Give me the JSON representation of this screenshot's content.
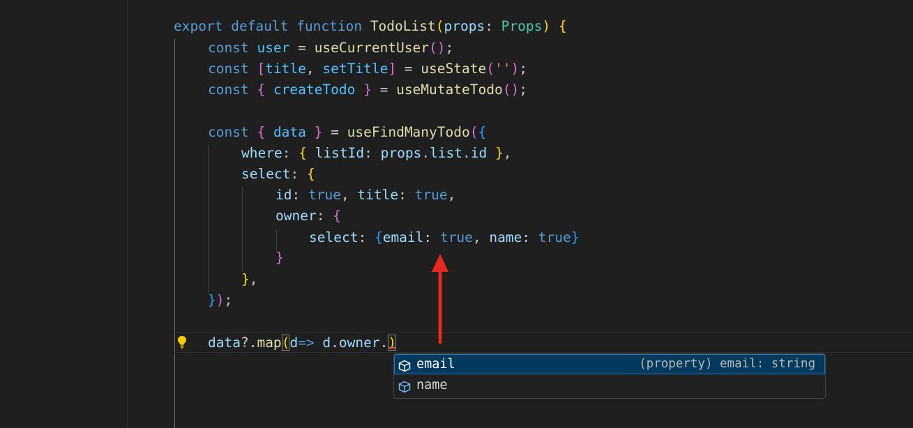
{
  "editor": {
    "language": "typescript",
    "lines": {
      "l1": [
        "export",
        "default",
        "function",
        "TodoList",
        "(",
        "props",
        ": ",
        "Props",
        ")",
        " {"
      ],
      "l2": [
        "const",
        "user",
        " = ",
        "useCurrentUser",
        "()",
        ";"
      ],
      "l3": [
        "const",
        "[",
        "title",
        ", ",
        "setTitle",
        "]",
        " = ",
        "useState",
        "(",
        "''",
        ")",
        ";"
      ],
      "l4": [
        "const",
        "{",
        " createTodo ",
        "}",
        " = ",
        "useMutateTodo",
        "()",
        ";"
      ],
      "l5": [
        "const",
        "{",
        " data ",
        "}",
        " = ",
        "useFindManyTodo",
        "(",
        "{"
      ],
      "l6": [
        "where",
        ": ",
        "{",
        " listId",
        ": ",
        "props",
        ".",
        "list",
        ".",
        "id",
        " }",
        ","
      ],
      "l7": [
        "select",
        ": ",
        "{"
      ],
      "l8": [
        "id",
        ": ",
        "true",
        ", ",
        "title",
        ": ",
        "true",
        ","
      ],
      "l9": [
        "owner",
        ": ",
        "{"
      ],
      "l10": [
        "select",
        ": ",
        "{",
        "email",
        ": ",
        "true",
        ", ",
        "name",
        ": ",
        "true",
        "}"
      ],
      "l11": [
        "}"
      ],
      "l12": [
        "}",
        ","
      ],
      "l13": [
        "}",
        ")",
        ";"
      ],
      "l14": [
        "data",
        "?.",
        "map",
        "(",
        "d",
        "=>",
        " d",
        ".",
        "owner",
        ".",
        ")"
      ]
    }
  },
  "suggest": {
    "items": [
      {
        "label": "email",
        "detail": "(property) email: string",
        "icon": "property-cube-icon"
      },
      {
        "label": "name",
        "detail": "",
        "icon": "property-cube-icon"
      }
    ]
  },
  "colors": {
    "background": "#1f1f1f",
    "keyword": "#569cd6",
    "function": "#dcdcaa",
    "variable": "#9cdcfe",
    "type": "#4ec9b0",
    "annotation_arrow": "#e8271e",
    "suggest_selected": "#04395e"
  }
}
